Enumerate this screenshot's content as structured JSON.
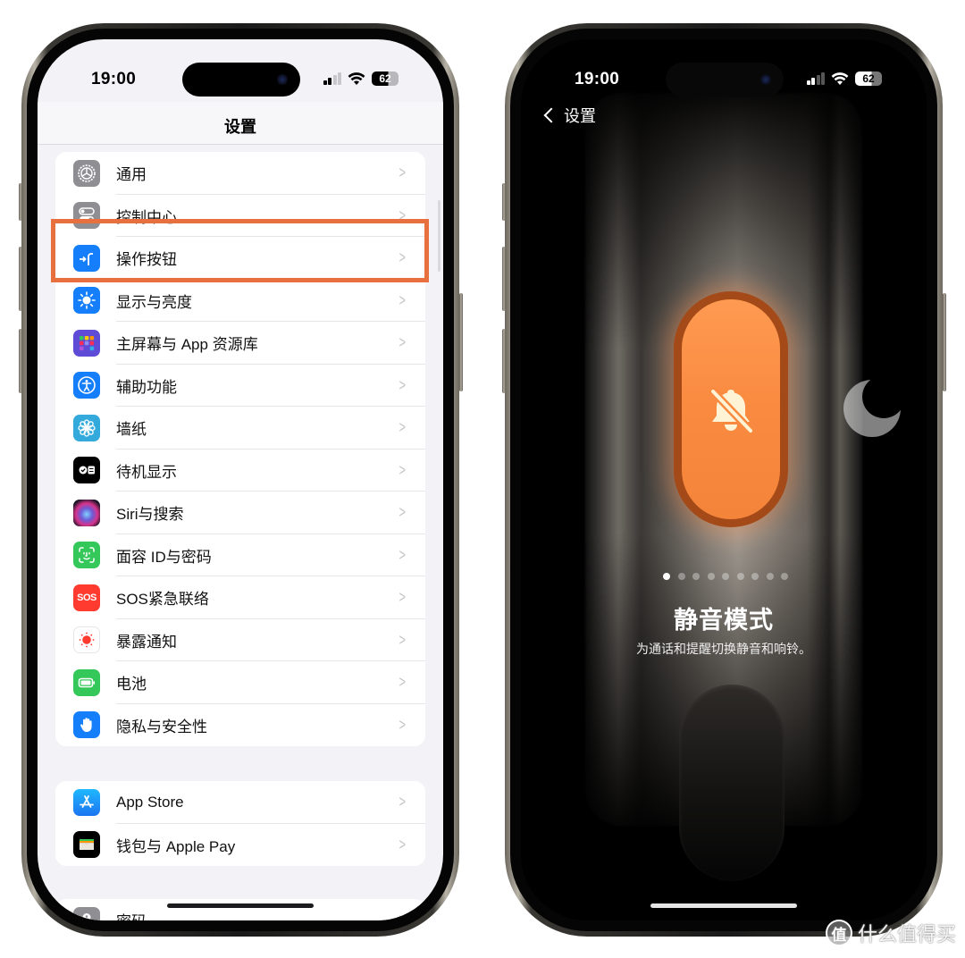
{
  "left_phone": {
    "status_bar": {
      "time": "19:00",
      "battery": "62"
    },
    "nav_title": "设置",
    "highlight_color": "#e8703f",
    "highlighted_item": "操作按钮",
    "groups": [
      {
        "items": [
          {
            "label": "通用",
            "icon": "gear-icon",
            "color": "#8e8e93"
          },
          {
            "label": "控制中心",
            "icon": "toggle-switches-icon",
            "color": "#8e8e93"
          },
          {
            "label": "操作按钮",
            "icon": "action-button-icon",
            "color": "#147efb"
          },
          {
            "label": "显示与亮度",
            "icon": "sun-icon",
            "color": "#147efb"
          },
          {
            "label": "主屏幕与 App 资源库",
            "icon": "app-grid-icon",
            "color": "#5e4bd6"
          },
          {
            "label": "辅助功能",
            "icon": "accessibility-icon",
            "color": "#147efb"
          },
          {
            "label": "墙纸",
            "icon": "flower-icon",
            "color": "#34aadc"
          },
          {
            "label": "待机显示",
            "icon": "standby-icon",
            "color": "#000000"
          },
          {
            "label": "Siri与搜索",
            "icon": "siri-icon",
            "color": "#2a1f3d"
          },
          {
            "label": "面容 ID与密码",
            "icon": "face-id-icon",
            "color": "#34c759"
          },
          {
            "label": "SOS紧急联络",
            "icon": "sos-icon",
            "color": "#ff3b30",
            "icon_text": "SOS"
          },
          {
            "label": "暴露通知",
            "icon": "exposure-icon",
            "color": "#ffffff"
          },
          {
            "label": "电池",
            "icon": "battery-icon",
            "color": "#34c759"
          },
          {
            "label": "隐私与安全性",
            "icon": "hand-icon",
            "color": "#147efb"
          }
        ]
      },
      {
        "items": [
          {
            "label": "App Store",
            "icon": "app-store-icon",
            "color": "#1e90ff"
          },
          {
            "label": "钱包与 Apple Pay",
            "icon": "wallet-icon",
            "color": "#000000"
          }
        ]
      },
      {
        "items": [
          {
            "label": "密码",
            "icon": "key-icon",
            "color": "#8e8e93"
          }
        ]
      }
    ]
  },
  "right_phone": {
    "status_bar": {
      "time": "19:00",
      "battery": "62"
    },
    "back_label": "设置",
    "action_icon": "bell-slash-icon",
    "side_icon": "moon-icon",
    "accent_color": "#f98a3f",
    "page_dots": {
      "total": 9,
      "active_index": 0
    },
    "mode_title": "静音模式",
    "mode_description": "为通话和提醒切换静音和响铃。"
  },
  "watermark": {
    "badge": "值",
    "text": "什么值得买"
  }
}
